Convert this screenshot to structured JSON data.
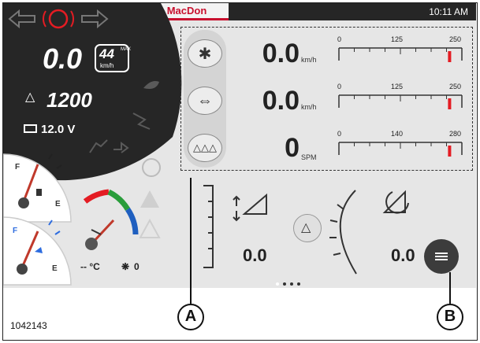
{
  "header": {
    "brand": "MacDon",
    "clock": "10:11 AM"
  },
  "left_panel": {
    "parking_brake_letter": "P",
    "ground_speed": "0.0",
    "max_speed_value": "44",
    "max_speed_label": "MAX",
    "max_speed_unit": "km/h",
    "engine_rpm": "1200",
    "battery_voltage": "12.0 V",
    "fuel_gauge_full": "F",
    "fuel_gauge_empty": "E",
    "def_gauge_full": "F",
    "def_gauge_empty": "E",
    "heater_readout": "-- °C",
    "fan_readout": "0"
  },
  "readouts": {
    "reel_speed": {
      "value": "0.0",
      "unit": "km/h",
      "ticks": [
        "0",
        "125",
        "250"
      ],
      "marker": 0.9
    },
    "draper_speed": {
      "value": "0.0",
      "unit": "km/h",
      "ticks": [
        "0",
        "125",
        "250"
      ],
      "marker": 0.9
    },
    "knife_speed": {
      "value": "0",
      "unit": "SPM",
      "ticks": [
        "0",
        "140",
        "280"
      ],
      "marker": 0.9
    }
  },
  "lower_tile": {
    "header_height": "0.0",
    "header_tilt": "0.0"
  },
  "pagination": {
    "pages": 4,
    "current": 1
  },
  "callouts": {
    "a": "A",
    "b": "B"
  },
  "figure_number": "1042143",
  "colors": {
    "brand_red": "#c8102e",
    "gauge_marker": "#e41c23",
    "green": "#2a9d3b",
    "panel_dark": "#262626"
  }
}
